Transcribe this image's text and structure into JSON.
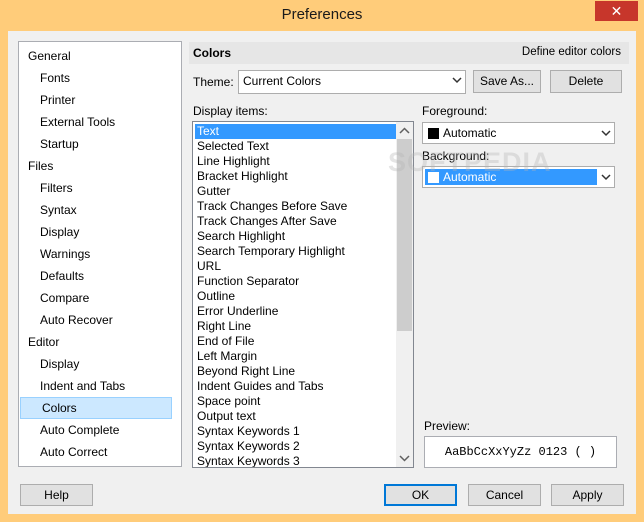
{
  "window": {
    "title": "Preferences",
    "close_icon": "close-icon"
  },
  "nav": {
    "items": [
      {
        "label": "General",
        "level": 0
      },
      {
        "label": "Fonts",
        "level": 1
      },
      {
        "label": "Printer",
        "level": 1
      },
      {
        "label": "External Tools",
        "level": 1
      },
      {
        "label": "Startup",
        "level": 1
      },
      {
        "label": "Files",
        "level": 0
      },
      {
        "label": "Filters",
        "level": 1
      },
      {
        "label": "Syntax",
        "level": 1
      },
      {
        "label": "Display",
        "level": 1
      },
      {
        "label": "Warnings",
        "level": 1
      },
      {
        "label": "Defaults",
        "level": 1
      },
      {
        "label": "Compare",
        "level": 1
      },
      {
        "label": "Auto Recover",
        "level": 1
      },
      {
        "label": "Editor",
        "level": 0
      },
      {
        "label": "Display",
        "level": 1
      },
      {
        "label": "Indent and Tabs",
        "level": 1
      },
      {
        "label": "Colors",
        "level": 1,
        "selected": true
      },
      {
        "label": "Auto Complete",
        "level": 1
      },
      {
        "label": "Auto Correct",
        "level": 1
      }
    ]
  },
  "panel": {
    "title": "Colors",
    "description": "Define editor colors",
    "theme_label": "Theme:",
    "theme_value": "Current Colors",
    "save_as_label": "Save As...",
    "delete_label": "Delete",
    "display_items_label": "Display items:",
    "display_items": [
      "Text",
      "Selected Text",
      "Line Highlight",
      "Bracket Highlight",
      "Gutter",
      "Track Changes Before Save",
      "Track Changes After Save",
      "Search Highlight",
      "Search Temporary Highlight",
      "URL",
      "Function Separator",
      "Outline",
      "Error Underline",
      "Right Line",
      "End of File",
      "Left Margin",
      "Beyond Right Line",
      "Indent Guides and Tabs",
      "Space point",
      "Output text",
      "Syntax Keywords 1",
      "Syntax Keywords 2",
      "Syntax Keywords 3"
    ],
    "selected_item": "Text",
    "foreground_label": "Foreground:",
    "foreground_value": "Automatic",
    "foreground_swatch": "#000000",
    "background_label": "Background:",
    "background_value": "Automatic",
    "background_swatch": "#ffffff",
    "preview_label": "Preview:",
    "preview_text": "AaBbCcXxYyZz 0123 ( )"
  },
  "footer": {
    "help_label": "Help",
    "ok_label": "OK",
    "cancel_label": "Cancel",
    "apply_label": "Apply"
  },
  "watermark": "SOFTPEDIA",
  "colors": {
    "title_bar": "#ffcc7a",
    "selection": "#3399ff",
    "nav_selection": "#cce8ff"
  }
}
